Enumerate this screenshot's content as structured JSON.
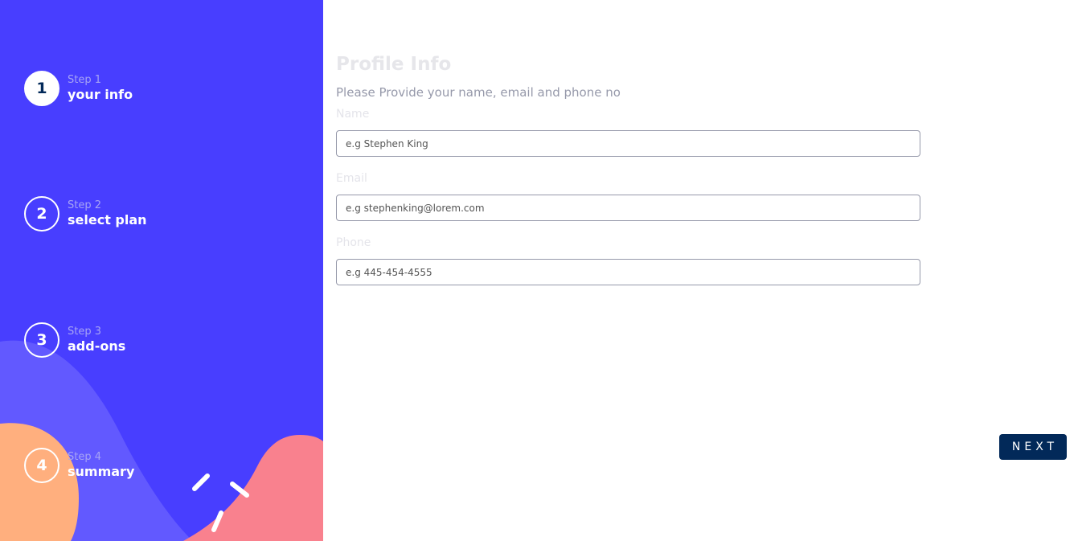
{
  "sidebar": {
    "steps": [
      {
        "number": "1",
        "label_small": "Step 1",
        "label_big": "your info",
        "active": true
      },
      {
        "number": "2",
        "label_small": "Step 2",
        "label_big": "select plan",
        "active": false
      },
      {
        "number": "3",
        "label_small": "Step 3",
        "label_big": "add-ons",
        "active": false
      },
      {
        "number": "4",
        "label_small": "Step 4",
        "label_big": "summary",
        "active": false
      }
    ]
  },
  "form": {
    "title": "Profile Info",
    "subtitle": "Please Provide your name, email and phone no",
    "fields": [
      {
        "label": "Name",
        "placeholder": "e.g Stephen King",
        "value": ""
      },
      {
        "label": "Email",
        "placeholder": "e.g stephenking@lorem.com",
        "value": ""
      },
      {
        "label": "Phone",
        "placeholder": "e.g 445-454-4555",
        "value": ""
      }
    ],
    "next_label": "NEXT"
  },
  "colors": {
    "sidebar_bg": "#483eff",
    "decor_purple": "#6259ff",
    "decor_orange": "#ffaf7e",
    "decor_pink": "#f9818e",
    "button_bg": "#022959"
  }
}
